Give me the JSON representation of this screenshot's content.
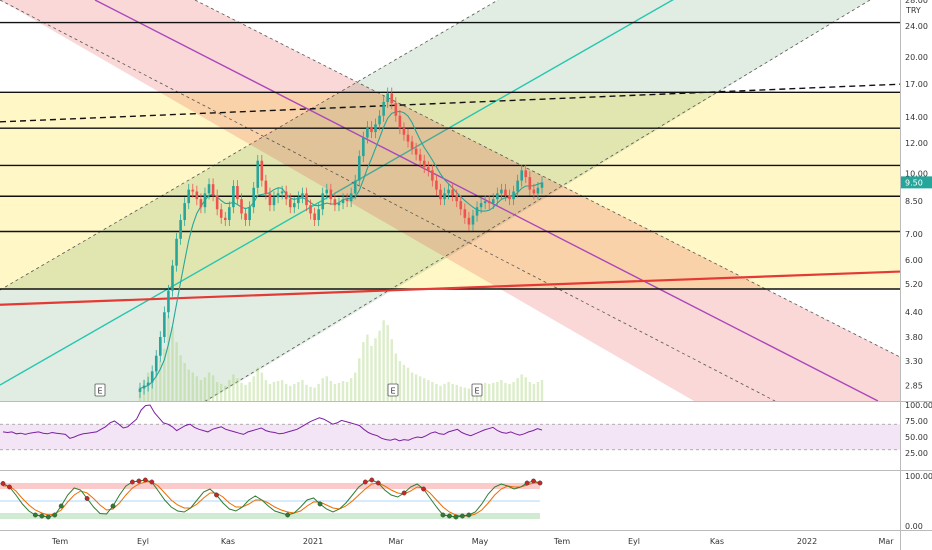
{
  "chart_data": {
    "type": "candlestick",
    "currency": "TRY",
    "last_price": 9.5,
    "last_price_label": "9.50",
    "y_axis": {
      "scale": "log",
      "range": [
        2.6,
        28.0
      ],
      "ticks": [
        {
          "v": 28.0,
          "label": "28.00"
        },
        {
          "v": 24.0,
          "label": "24.00"
        },
        {
          "v": 20.0,
          "label": "20.00"
        },
        {
          "v": 17.0,
          "label": "17.00"
        },
        {
          "v": 14.0,
          "label": "14.00"
        },
        {
          "v": 12.0,
          "label": "12.00"
        },
        {
          "v": 10.0,
          "label": "10.00"
        },
        {
          "v": 8.5,
          "label": "8.50"
        },
        {
          "v": 7.0,
          "label": "7.00"
        },
        {
          "v": 6.0,
          "label": "6.00"
        },
        {
          "v": 5.2,
          "label": "5.20"
        },
        {
          "v": 4.4,
          "label": "4.40"
        },
        {
          "v": 3.8,
          "label": "3.80"
        },
        {
          "v": 3.3,
          "label": "3.30"
        },
        {
          "v": 2.85,
          "label": "2.85"
        }
      ]
    },
    "x_axis": {
      "labels": [
        "Tem",
        "Eyl",
        "Kas",
        "2021",
        "Mar",
        "May",
        "Tem",
        "Eyl",
        "Kas",
        "2022",
        "Mar"
      ]
    },
    "horizontal_levels": [
      24.5,
      16.2,
      13.1,
      10.5,
      8.75,
      7.1,
      5.05
    ],
    "zones": [
      {
        "from": 5.05,
        "to": 7.1,
        "color": "#fff7c7"
      },
      {
        "from": 7.1,
        "to": 8.75,
        "color": "#fff7c7"
      },
      {
        "from": 8.75,
        "to": 10.5,
        "color": "#fff7c7"
      },
      {
        "from": 10.5,
        "to": 13.1,
        "color": "#fff7c7"
      },
      {
        "from": 13.1,
        "to": 16.2,
        "color": "#fff7c7"
      }
    ],
    "trendlines": [
      {
        "name": "support",
        "color": "#e53935",
        "dashed": false,
        "from": 4.6,
        "to": 5.6
      },
      {
        "name": "resistance",
        "color": "#111111",
        "dashed": true,
        "from": 13.6,
        "to": 17.0
      }
    ],
    "price_closes": [
      2.8,
      2.85,
      2.9,
      3.1,
      3.4,
      3.8,
      4.4,
      5.0,
      5.8,
      6.8,
      7.6,
      8.4,
      9.1,
      9.0,
      8.6,
      8.2,
      8.9,
      9.4,
      8.8,
      8.1,
      7.7,
      7.6,
      8.2,
      9.3,
      8.6,
      7.9,
      7.6,
      8.2,
      9.2,
      10.8,
      9.6,
      8.9,
      8.3,
      8.7,
      8.9,
      9.0,
      8.6,
      8.2,
      8.4,
      8.7,
      8.9,
      8.3,
      7.9,
      7.6,
      8.1,
      8.9,
      9.1,
      8.6,
      8.3,
      8.4,
      8.6,
      8.5,
      8.9,
      9.6,
      11.1,
      12.4,
      13.2,
      12.8,
      13.4,
      14.1,
      15.3,
      16.1,
      15.2,
      14.1,
      13.1,
      12.6,
      12.1,
      11.6,
      11.2,
      10.8,
      10.4,
      10.2,
      9.6,
      9.1,
      8.6,
      8.9,
      9.1,
      8.8,
      8.5,
      8.1,
      7.7,
      7.4,
      7.8,
      8.2,
      8.4,
      8.5,
      8.4,
      8.6,
      8.9,
      9.1,
      8.8,
      8.6,
      9.0,
      9.6,
      10.2,
      9.8,
      9.1,
      8.9,
      9.2,
      9.5
    ],
    "volume": [
      0.15,
      0.22,
      0.3,
      0.28,
      0.35,
      0.42,
      0.55,
      0.9,
      0.78,
      0.62,
      0.48,
      0.4,
      0.33,
      0.3,
      0.26,
      0.22,
      0.25,
      0.3,
      0.27,
      0.2,
      0.18,
      0.16,
      0.22,
      0.28,
      0.24,
      0.19,
      0.17,
      0.2,
      0.26,
      0.35,
      0.3,
      0.22,
      0.18,
      0.2,
      0.21,
      0.22,
      0.18,
      0.16,
      0.18,
      0.2,
      0.22,
      0.17,
      0.15,
      0.14,
      0.18,
      0.24,
      0.26,
      0.21,
      0.18,
      0.19,
      0.21,
      0.2,
      0.24,
      0.3,
      0.45,
      0.62,
      0.7,
      0.58,
      0.66,
      0.74,
      0.85,
      0.8,
      0.65,
      0.5,
      0.42,
      0.38,
      0.35,
      0.3,
      0.28,
      0.26,
      0.24,
      0.22,
      0.2,
      0.18,
      0.16,
      0.18,
      0.2,
      0.18,
      0.17,
      0.15,
      0.14,
      0.13,
      0.15,
      0.17,
      0.18,
      0.19,
      0.18,
      0.19,
      0.2,
      0.22,
      0.19,
      0.18,
      0.2,
      0.24,
      0.28,
      0.25,
      0.2,
      0.18,
      0.2,
      0.22
    ],
    "event_markers": [
      "E",
      "E",
      "E"
    ],
    "rsi": {
      "ticks": [
        {
          "v": 100,
          "label": "100.00"
        },
        {
          "v": 75,
          "label": "75.00"
        },
        {
          "v": 50,
          "label": "50.00"
        },
        {
          "v": 25,
          "label": "25.00"
        }
      ],
      "upper": 70,
      "lower": 30,
      "values": [
        58,
        57,
        58,
        55,
        56,
        54,
        56,
        57,
        58,
        56,
        55,
        57,
        56,
        55,
        54,
        48,
        50,
        53,
        55,
        56,
        57,
        58,
        62,
        66,
        72,
        75,
        70,
        64,
        66,
        72,
        78,
        92,
        99,
        100,
        88,
        80,
        72,
        70,
        66,
        60,
        64,
        68,
        70,
        65,
        62,
        60,
        58,
        62,
        64,
        66,
        62,
        60,
        58,
        56,
        54,
        58,
        60,
        62,
        64,
        60,
        58,
        57,
        55,
        56,
        58,
        60,
        62,
        66,
        70,
        74,
        77,
        80,
        78,
        74,
        70,
        72,
        76,
        74,
        72,
        70,
        68,
        62,
        57,
        54,
        52,
        48,
        46,
        45,
        47,
        44,
        46,
        45,
        48,
        50,
        49,
        52,
        56,
        58,
        55,
        54,
        58,
        60,
        62,
        57,
        54,
        52,
        55,
        58,
        61,
        63,
        65,
        60,
        57,
        56,
        58,
        55,
        53,
        55,
        58,
        60,
        63,
        61
      ]
    },
    "stoch": {
      "ticks": [
        {
          "v": 100,
          "label": "100.00"
        },
        {
          "v": 0,
          "label": "0.00"
        }
      ],
      "upper": 80,
      "lower": 20,
      "k": [
        85,
        78,
        62,
        44,
        30,
        22,
        20,
        18,
        22,
        40,
        62,
        76,
        72,
        55,
        38,
        25,
        24,
        40,
        62,
        80,
        88,
        90,
        92,
        88,
        70,
        52,
        38,
        30,
        28,
        36,
        52,
        68,
        74,
        62,
        46,
        34,
        30,
        38,
        52,
        60,
        52,
        40,
        30,
        26,
        22,
        26,
        38,
        52,
        56,
        44,
        34,
        28,
        34,
        46,
        62,
        78,
        88,
        92,
        86,
        72,
        62,
        58,
        66,
        78,
        84,
        74,
        56,
        38,
        22,
        20,
        18,
        20,
        22,
        28,
        44,
        64,
        78,
        84,
        80,
        74,
        78,
        86,
        90,
        86
      ],
      "d": [
        80,
        80,
        70,
        55,
        42,
        32,
        26,
        22,
        24,
        32,
        48,
        62,
        70,
        66,
        55,
        42,
        32,
        34,
        46,
        62,
        76,
        84,
        88,
        88,
        80,
        66,
        52,
        42,
        36,
        36,
        44,
        56,
        66,
        66,
        58,
        46,
        38,
        38,
        44,
        52,
        52,
        46,
        38,
        32,
        28,
        26,
        30,
        40,
        48,
        48,
        42,
        36,
        34,
        40,
        50,
        62,
        74,
        84,
        86,
        80,
        72,
        66,
        64,
        70,
        78,
        76,
        66,
        52,
        38,
        28,
        22,
        20,
        20,
        24,
        32,
        46,
        62,
        74,
        80,
        78,
        78,
        82,
        86,
        86
      ]
    }
  }
}
